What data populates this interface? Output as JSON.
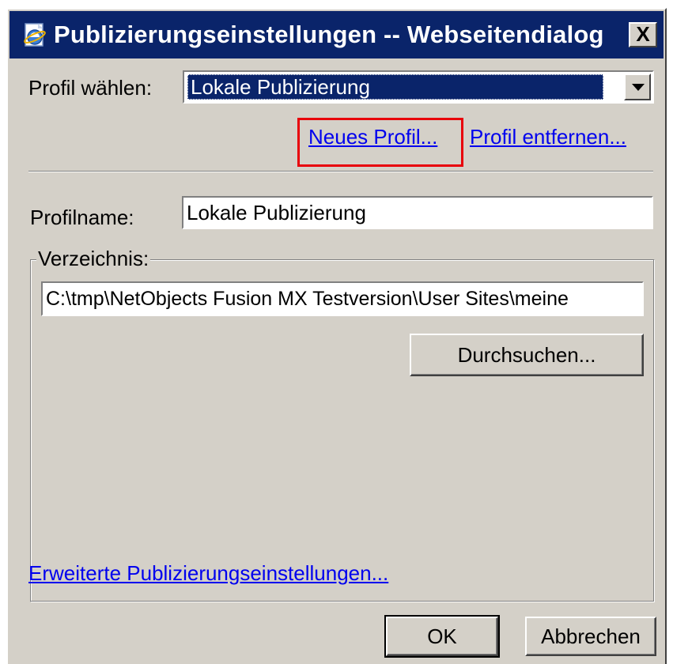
{
  "window": {
    "title": "Publizierungseinstellungen -- Webseitendialog",
    "title_icon": "ie-page-icon",
    "close_label": "X"
  },
  "profile_select": {
    "label": "Profil wählen:",
    "selected": "Lokale Publizierung"
  },
  "links": {
    "new_profile": "Neues Profil...",
    "remove_profile": "Profil entfernen...",
    "advanced": "Erweiterte Publizierungseinstellungen..."
  },
  "profile_name": {
    "label": "Profilname:",
    "value": "Lokale Publizierung"
  },
  "directory": {
    "legend": "Verzeichnis:",
    "value": "C:\\tmp\\NetObjects Fusion MX Testversion\\User Sites\\meine",
    "browse_label": "Durchsuchen..."
  },
  "footer": {
    "ok_label": "OK",
    "cancel_label": "Abbrechen"
  },
  "colors": {
    "titlebar": "#0a246a",
    "face": "#d4d0c8",
    "link": "#0000ee",
    "highlight": "#e8000a"
  }
}
